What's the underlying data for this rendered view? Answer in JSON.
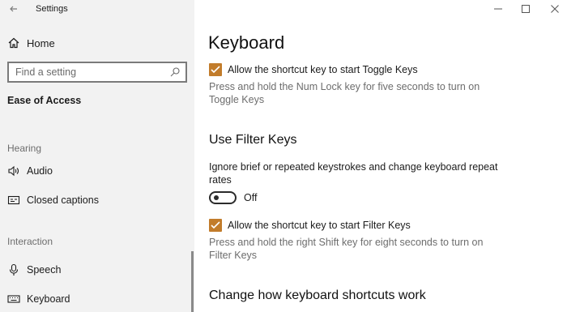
{
  "window": {
    "title": "Settings"
  },
  "sidebar": {
    "home_label": "Home",
    "search_placeholder": "Find a setting",
    "section_title": "Ease of Access",
    "groups": [
      {
        "label": "Hearing"
      },
      {
        "label": "Interaction"
      }
    ],
    "items": [
      {
        "label": "Audio",
        "icon": "speaker-icon"
      },
      {
        "label": "Closed captions",
        "icon": "closed-captions-icon"
      },
      {
        "label": "Speech",
        "icon": "microphone-icon"
      },
      {
        "label": "Keyboard",
        "icon": "keyboard-icon"
      }
    ]
  },
  "main": {
    "title": "Keyboard",
    "toggle_keys": {
      "shortcut_label": "Allow the shortcut key to start Toggle Keys",
      "shortcut_checked": true,
      "help": "Press and hold the Num Lock key for five seconds to turn on Toggle Keys"
    },
    "filter_keys": {
      "heading": "Use Filter Keys",
      "description": "Ignore brief or repeated keystrokes and change keyboard repeat rates",
      "toggle_state": "Off",
      "shortcut_label": "Allow the shortcut key to start Filter Keys",
      "shortcut_checked": true,
      "help": "Press and hold the right Shift key for eight seconds to turn on Filter Keys"
    },
    "change_shortcuts_heading": "Change how keyboard shortcuts work"
  },
  "colors": {
    "accent": "#c27c2b",
    "sidebar_bg": "#f2f2f2",
    "secondary_text": "#6d6d6d"
  }
}
